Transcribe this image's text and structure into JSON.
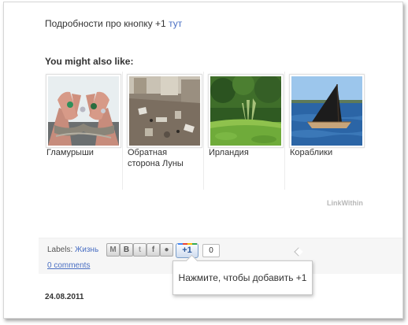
{
  "details": {
    "text": "Подробности про кнопку +1",
    "link": "тут"
  },
  "related": {
    "heading": "You might also like:",
    "items": [
      {
        "label": "Гламурыши",
        "image": "hands-with-rings-photo"
      },
      {
        "label": "Обратная сторона Луны",
        "image": "messy-room-photo"
      },
      {
        "label": "Ирландия",
        "image": "garden-photo"
      },
      {
        "label": "Кораблики",
        "image": "sailboat-photo"
      }
    ],
    "brand": "LinkWithin"
  },
  "footer": {
    "labels_prefix": "Labels:",
    "label_link": "Жизнь",
    "comments": "0 comments",
    "share_icons": [
      "email-icon",
      "blogger-icon",
      "twitter-icon",
      "facebook-icon",
      "buzz-icon"
    ],
    "plusone": "+1",
    "plusone_count": "0"
  },
  "tooltip": "Нажмите, чтобы добавить +1",
  "post_date": "24.08.2011"
}
